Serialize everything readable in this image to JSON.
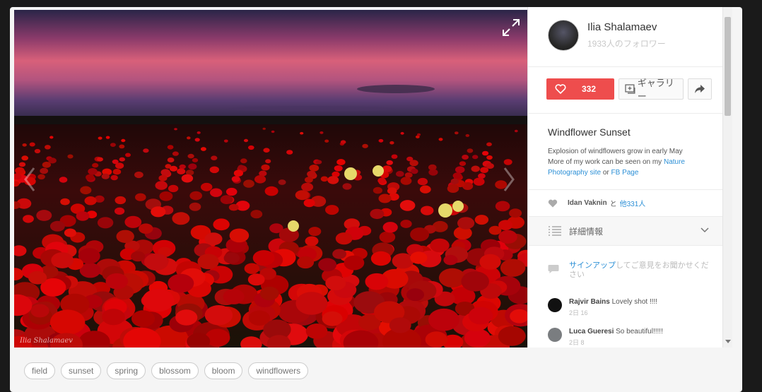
{
  "photo": {
    "watermark": "Ilia Shalamaev"
  },
  "author": {
    "name": "Ilia Shalamaev",
    "followers": "1933人のフォロワー"
  },
  "actions": {
    "like_count": "332",
    "gallery_label": "ギャラリー"
  },
  "photo_info": {
    "title": "Windflower Sunset",
    "desc_line1": "Explosion of windflowers grow in early May",
    "desc_line2_prefix": "More of my work can be seen on my ",
    "desc_link1": "Nature Photography site",
    "desc_or": " or ",
    "desc_link2": "FB Page"
  },
  "likes": {
    "liker": "Idan Vaknin",
    "and": "と",
    "others": "他331人"
  },
  "details": {
    "label": "詳細情報"
  },
  "comment_input": {
    "signup": "サインアップ",
    "rest": "してご意見をお聞かせください"
  },
  "comments": [
    {
      "name": "Rajvir Bains",
      "text": "Lovely shot !!!!",
      "time": "2日 16"
    },
    {
      "name": "Luca Gueresi",
      "text": "So beautiful!!!!!",
      "time": "2日 8"
    }
  ],
  "tags": [
    "field",
    "sunset",
    "spring",
    "blossom",
    "bloom",
    "windflowers"
  ],
  "colors": {
    "like_red": "#ee4d4d",
    "link_blue": "#2b8fd6"
  }
}
